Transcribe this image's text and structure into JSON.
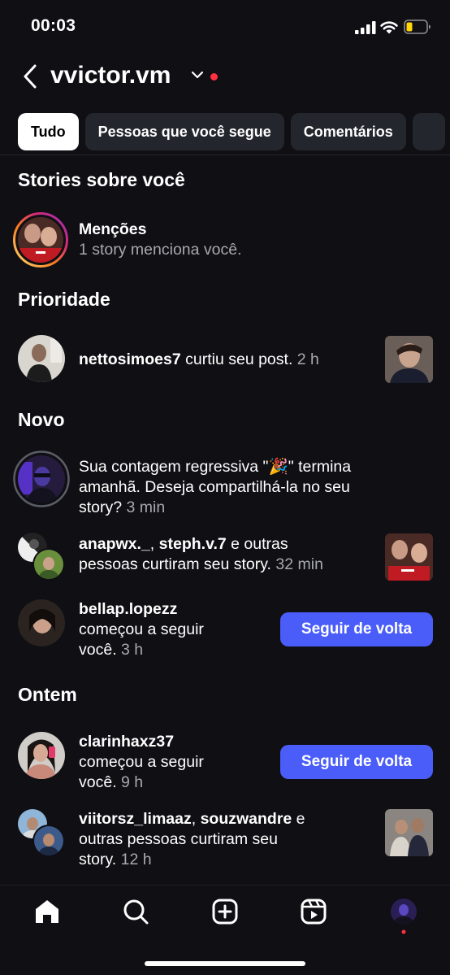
{
  "status_bar": {
    "time": "00:03"
  },
  "header": {
    "username": "vvictor.vm"
  },
  "tabs": [
    {
      "label": "Tudo"
    },
    {
      "label": "Pessoas que você segue"
    },
    {
      "label": "Comentários"
    },
    {
      "label": ""
    }
  ],
  "sections": {
    "stories": "Stories sobre você",
    "priority": "Prioridade",
    "new": "Novo",
    "yesterday": "Ontem"
  },
  "mentions": {
    "title": "Menções",
    "subtitle": "1 story menciona você."
  },
  "priority_item": {
    "user": "nettosimoes7",
    "action": " curtiu seu post.",
    "time": "2 h"
  },
  "countdown_item": {
    "line1": "Sua contagem regressiva \"🎉\" termina",
    "line2": "amanhã. Deseja compartilhá-la no seu",
    "line3": "story?",
    "time": "3 min"
  },
  "story_likes": {
    "user1": "anapwx._",
    "sep": ", ",
    "user2": "steph.v.7",
    "rest": " e outras",
    "line2": "pessoas curtiram seu story.",
    "time": "32 min"
  },
  "follow1": {
    "user": "bellap.lopezz",
    "line2": "começou a seguir",
    "line3": "você.",
    "time": "3 h",
    "button": "Seguir de volta"
  },
  "follow2": {
    "user": "clarinhaxz37",
    "line2": "começou a seguir",
    "line3": "você.",
    "time": "9 h",
    "button": "Seguir de volta"
  },
  "story_likes2": {
    "user1": "viitorsz_limaaz",
    "sep": ", ",
    "user2": "souzwandre",
    "rest": " e",
    "line2": "outras pessoas curtiram seu",
    "line3": "story.",
    "time": "12 h"
  },
  "nav": [
    "home-icon",
    "search-icon",
    "create-icon",
    "reels-icon",
    "profile-avatar"
  ],
  "colors": {
    "accent": "#4a5df9",
    "notification_dot": "#ff3040",
    "background": "#0f0f14"
  }
}
